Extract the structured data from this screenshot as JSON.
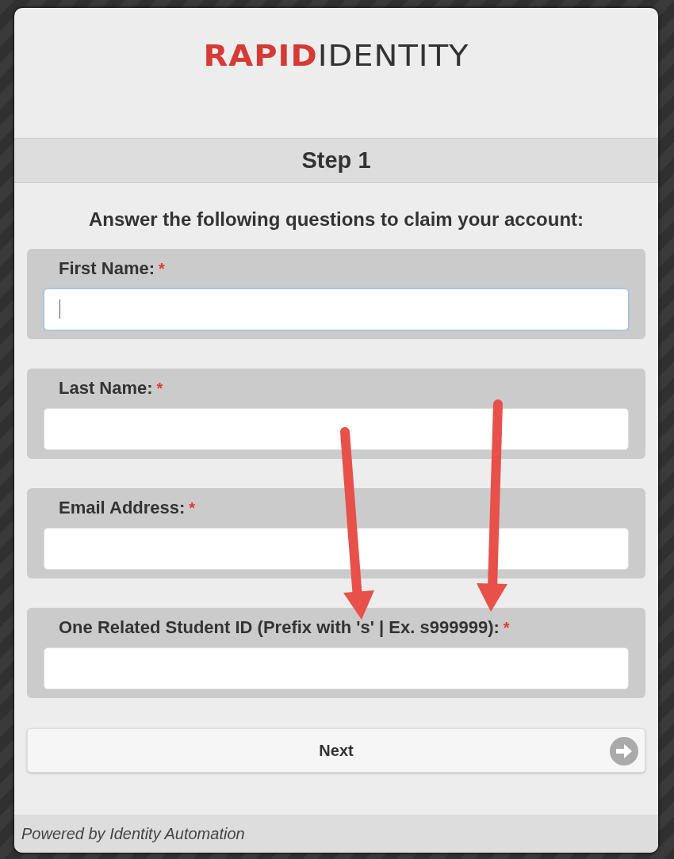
{
  "logo": "**RAPID**IDENTITY",
  "step_title": "Step 1",
  "instructions": "Answer the following questions to claim your account:",
  "fields": [
    {
      "label": "First Name:",
      "required": true,
      "focused": true
    },
    {
      "label": "Last Name:",
      "required": true,
      "focused": false
    },
    {
      "label": "Email Address:",
      "required": true,
      "focused": false
    },
    {
      "label": "One Related Student ID (Prefix with 's' | Ex. s999999):",
      "required": true,
      "focused": false
    }
  ],
  "required_mark": "*",
  "next_button": {
    "label": "Next"
  },
  "footer": "Powered by Identity Automation"
}
